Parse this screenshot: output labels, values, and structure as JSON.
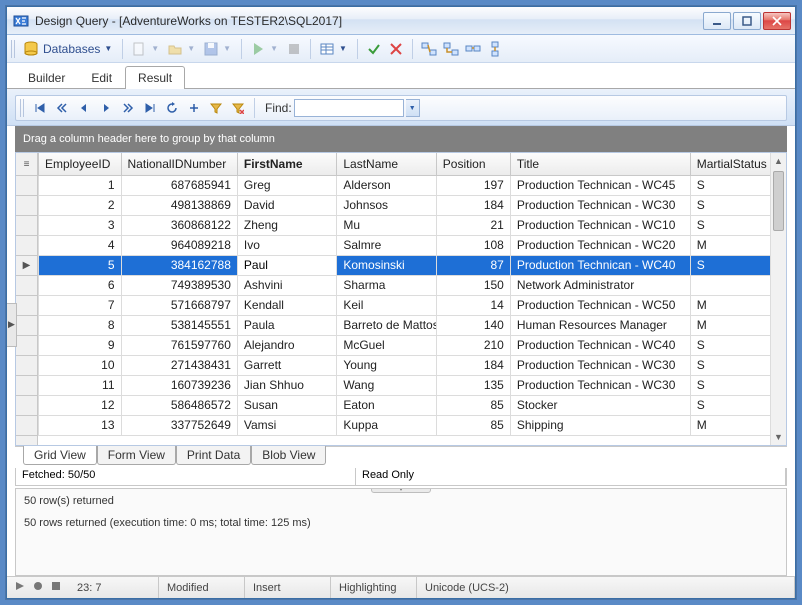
{
  "window": {
    "title": "Design Query - [AdventureWorks on TESTER2\\SQL2017]"
  },
  "toolbar": {
    "databases_label": "Databases"
  },
  "tabs": {
    "builder": "Builder",
    "edit": "Edit",
    "result": "Result",
    "active": "Result"
  },
  "nav": {
    "find_label": "Find:",
    "find_value": ""
  },
  "group_hint": "Drag a column header here to group by that column",
  "columns": {
    "EmployeeID": "EmployeeID",
    "NationalIDNumber": "NationalIDNumber",
    "FirstName": "FirstName",
    "LastName": "LastName",
    "Position": "Position",
    "Title": "Title",
    "MartialStatus": "MartialStatus"
  },
  "sorted_column": "FirstName",
  "selected_row_index": 4,
  "editing_cell_column": "FirstName",
  "rows": [
    {
      "EmployeeID": 1,
      "NationalIDNumber": 687685941,
      "FirstName": "Greg",
      "LastName": "Alderson",
      "Position": 197,
      "Title": "Production Technican - WC45",
      "MartialStatus": "S"
    },
    {
      "EmployeeID": 2,
      "NationalIDNumber": 498138869,
      "FirstName": "David",
      "LastName": "Johnsos",
      "Position": 184,
      "Title": "Production Technican - WC30",
      "MartialStatus": "S"
    },
    {
      "EmployeeID": 3,
      "NationalIDNumber": 360868122,
      "FirstName": "Zheng",
      "LastName": "Mu",
      "Position": 21,
      "Title": "Production Technican - WC10",
      "MartialStatus": "S"
    },
    {
      "EmployeeID": 4,
      "NationalIDNumber": 964089218,
      "FirstName": "Ivo",
      "LastName": "Salmre",
      "Position": 108,
      "Title": "Production Technican - WC20",
      "MartialStatus": "M"
    },
    {
      "EmployeeID": 5,
      "NationalIDNumber": 384162788,
      "FirstName": "Paul",
      "LastName": "Komosinski",
      "Position": 87,
      "Title": "Production Technican - WC40",
      "MartialStatus": "S"
    },
    {
      "EmployeeID": 6,
      "NationalIDNumber": 749389530,
      "FirstName": "Ashvini",
      "LastName": "Sharma",
      "Position": 150,
      "Title": "Network Administrator",
      "MartialStatus": ""
    },
    {
      "EmployeeID": 7,
      "NationalIDNumber": 571668797,
      "FirstName": "Kendall",
      "LastName": "Keil",
      "Position": 14,
      "Title": "Production Technican - WC50",
      "MartialStatus": "M"
    },
    {
      "EmployeeID": 8,
      "NationalIDNumber": 538145551,
      "FirstName": "Paula",
      "LastName": "Barreto de Mattos",
      "Position": 140,
      "Title": "Human Resources Manager",
      "MartialStatus": "M"
    },
    {
      "EmployeeID": 9,
      "NationalIDNumber": 761597760,
      "FirstName": "Alejandro",
      "LastName": "McGuel",
      "Position": 210,
      "Title": "Production Technican - WC40",
      "MartialStatus": "S"
    },
    {
      "EmployeeID": 10,
      "NationalIDNumber": 271438431,
      "FirstName": "Garrett",
      "LastName": "Young",
      "Position": 184,
      "Title": "Production Technican - WC30",
      "MartialStatus": "S"
    },
    {
      "EmployeeID": 11,
      "NationalIDNumber": 160739236,
      "FirstName": "Jian Shhuo",
      "LastName": "Wang",
      "Position": 135,
      "Title": "Production Technican - WC30",
      "MartialStatus": "S"
    },
    {
      "EmployeeID": 12,
      "NationalIDNumber": 586486572,
      "FirstName": "Susan",
      "LastName": "Eaton",
      "Position": 85,
      "Title": "Stocker",
      "MartialStatus": "S"
    },
    {
      "EmployeeID": 13,
      "NationalIDNumber": 337752649,
      "FirstName": "Vamsi",
      "LastName": "Kuppa",
      "Position": 85,
      "Title": "Shipping",
      "MartialStatus": "M"
    }
  ],
  "bottom_tabs": {
    "grid": "Grid View",
    "form": "Form View",
    "print": "Print Data",
    "blob": "Blob View",
    "active": "grid"
  },
  "status_line": {
    "fetched": "Fetched: 50/50",
    "readonly": "Read Only"
  },
  "messages": {
    "line1": "50 row(s) returned",
    "line2": "50 rows returned (execution time: 0 ms; total time: 125 ms)"
  },
  "statusbar": {
    "line": "23:",
    "col": "7",
    "modified": "Modified",
    "insert": "Insert",
    "highlighting": "Highlighting",
    "encoding": "Unicode (UCS-2)"
  }
}
